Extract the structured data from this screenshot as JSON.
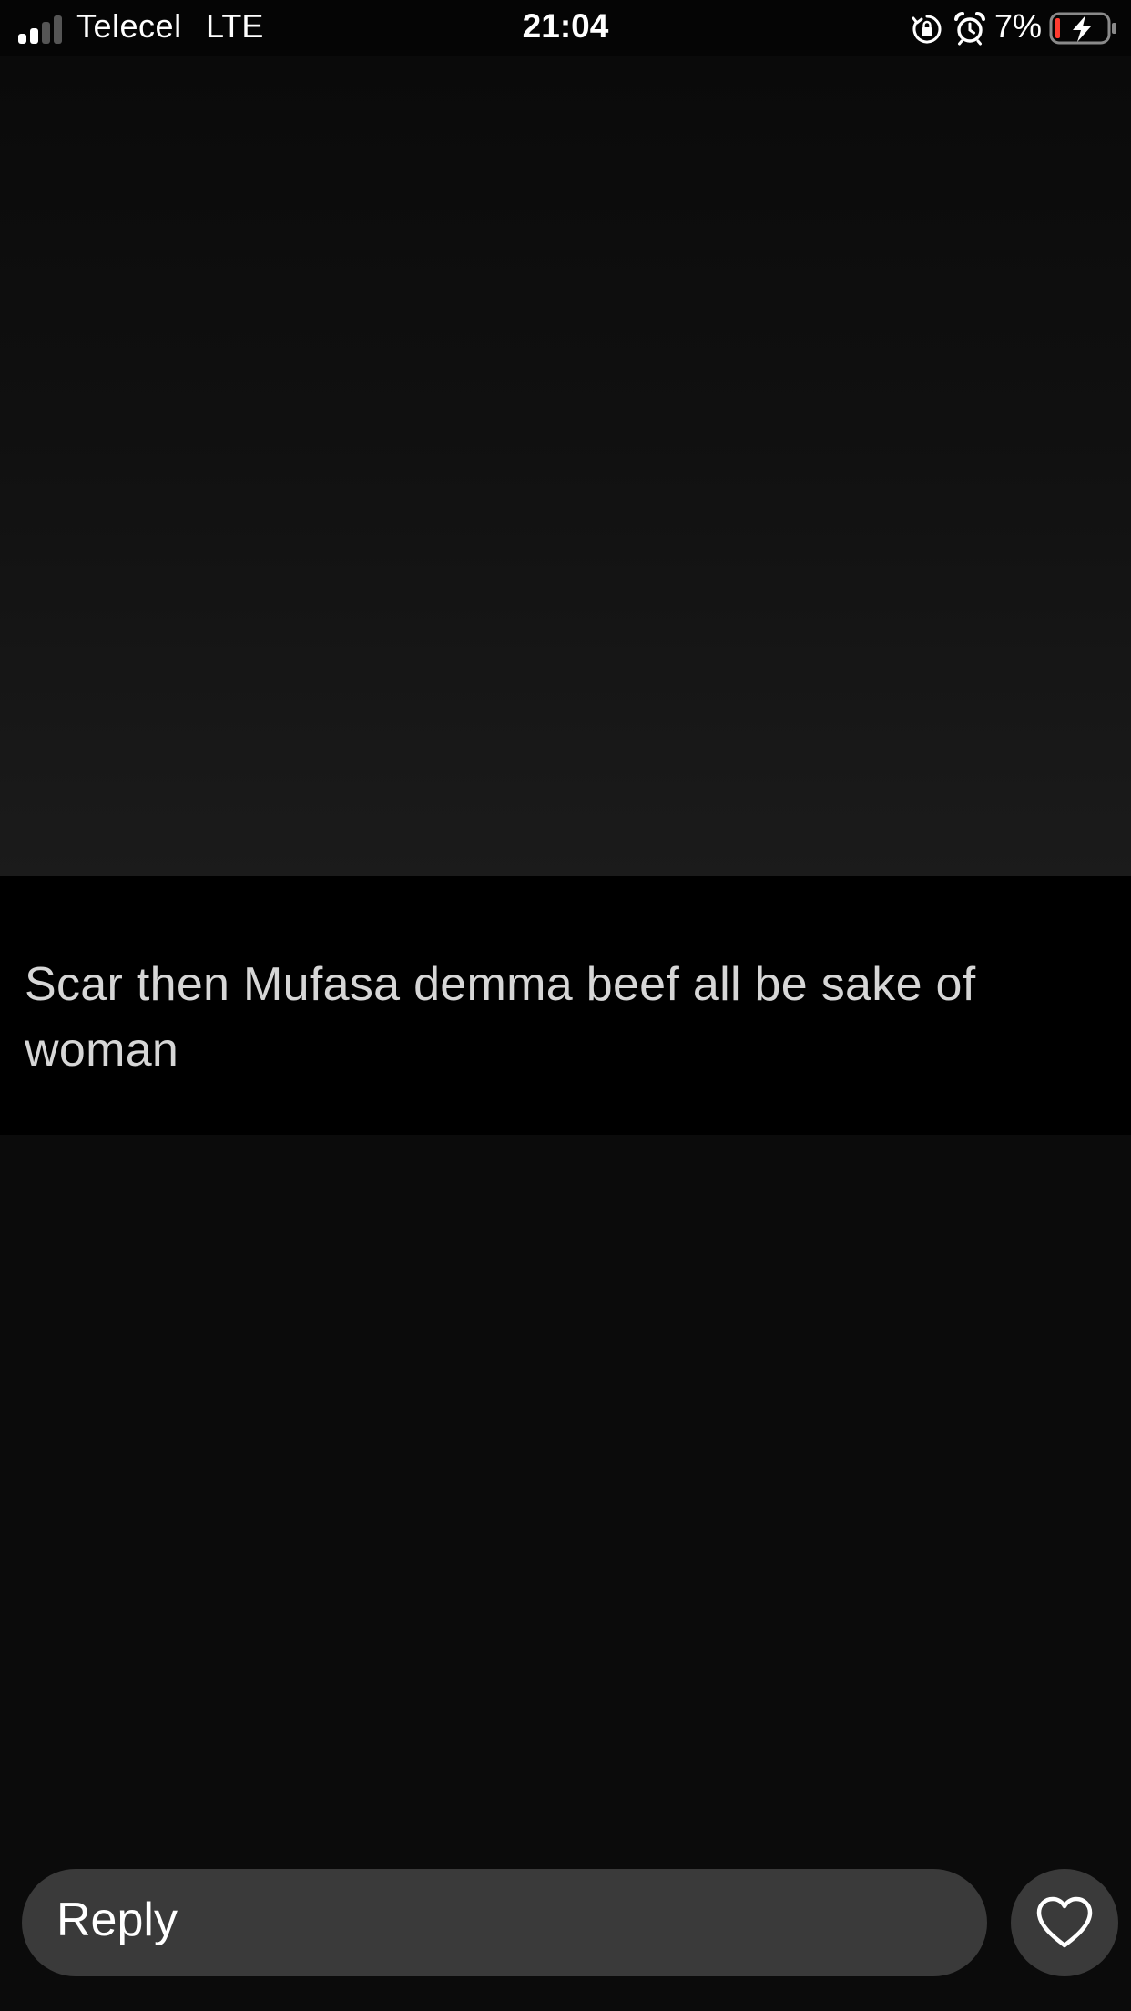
{
  "status_bar": {
    "carrier": "Telecel",
    "network": "LTE",
    "time": "21:04",
    "battery_percent": "7%",
    "signal_bars_active": 2,
    "signal_bars_total": 4,
    "icons": [
      "signal-icon",
      "orientation-lock-icon",
      "alarm-icon",
      "battery-charging-icon"
    ]
  },
  "story": {
    "comment_text": "Scar then Mufasa demma beef all be sake of woman"
  },
  "reply_bar": {
    "placeholder": "Reply",
    "like_icon": "heart-icon"
  },
  "colors": {
    "background": "#0a0a0a",
    "input_fill": "#3a3a3a",
    "battery_low": "#ff3b30"
  }
}
